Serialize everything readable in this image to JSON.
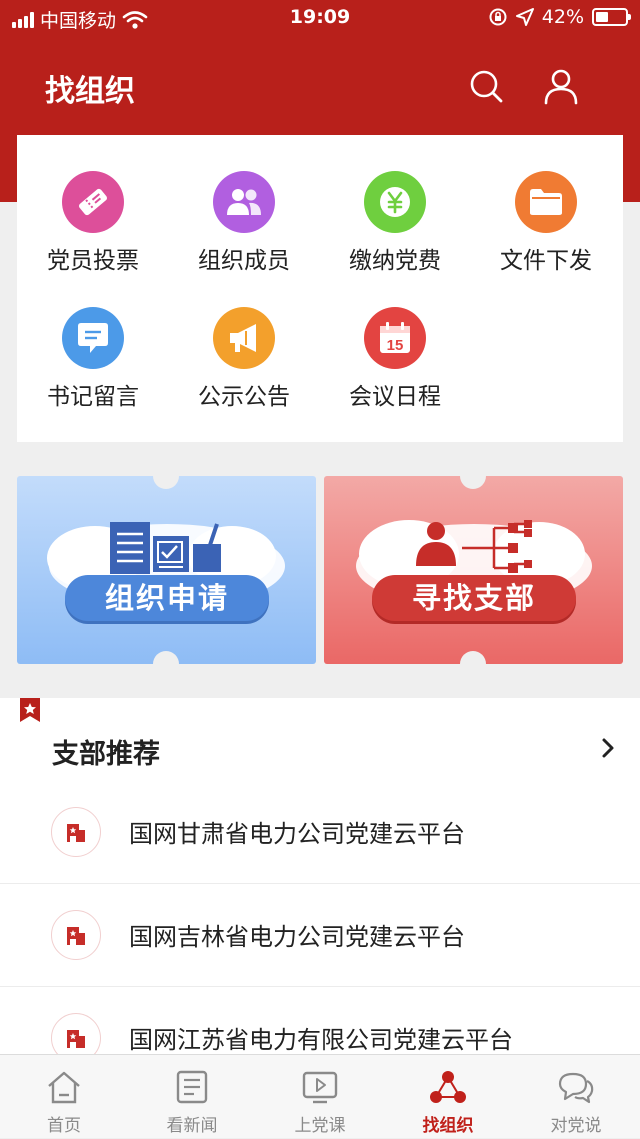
{
  "status": {
    "carrier": "中国移动",
    "time": "19:09",
    "battery": "42%",
    "battery_level": 0.42
  },
  "header": {
    "title": "找组织"
  },
  "grid": [
    {
      "label": "党员投票",
      "icon": "ticket-icon",
      "color": "#dd4f9a"
    },
    {
      "label": "组织成员",
      "icon": "members-icon",
      "color": "#b15fe0"
    },
    {
      "label": "缴纳党费",
      "icon": "yen-icon",
      "color": "#6fcf3f"
    },
    {
      "label": "文件下发",
      "icon": "folder-icon",
      "color": "#f07b33"
    },
    {
      "label": "书记留言",
      "icon": "message-icon",
      "color": "#4c9ae8"
    },
    {
      "label": "公示公告",
      "icon": "megaphone-icon",
      "color": "#f3a02c"
    },
    {
      "label": "会议日程",
      "icon": "calendar-icon",
      "color": "#e34441",
      "day": "15"
    }
  ],
  "banners": [
    {
      "label": "组织申请"
    },
    {
      "label": "寻找支部"
    }
  ],
  "recommend": {
    "title": "支部推荐",
    "items": [
      {
        "name": "国网甘肃省电力公司党建云平台"
      },
      {
        "name": "国网吉林省电力公司党建云平台"
      },
      {
        "name": "国网江苏省电力有限公司党建云平台"
      }
    ]
  },
  "tabs": [
    {
      "label": "首页"
    },
    {
      "label": "看新闻"
    },
    {
      "label": "上党课"
    },
    {
      "label": "找组织",
      "active": true
    },
    {
      "label": "对党说"
    }
  ],
  "colors": {
    "brand_red": "#b8201b",
    "active_tab": "#c0211b",
    "inactive_tab": "#8a8a8a"
  }
}
